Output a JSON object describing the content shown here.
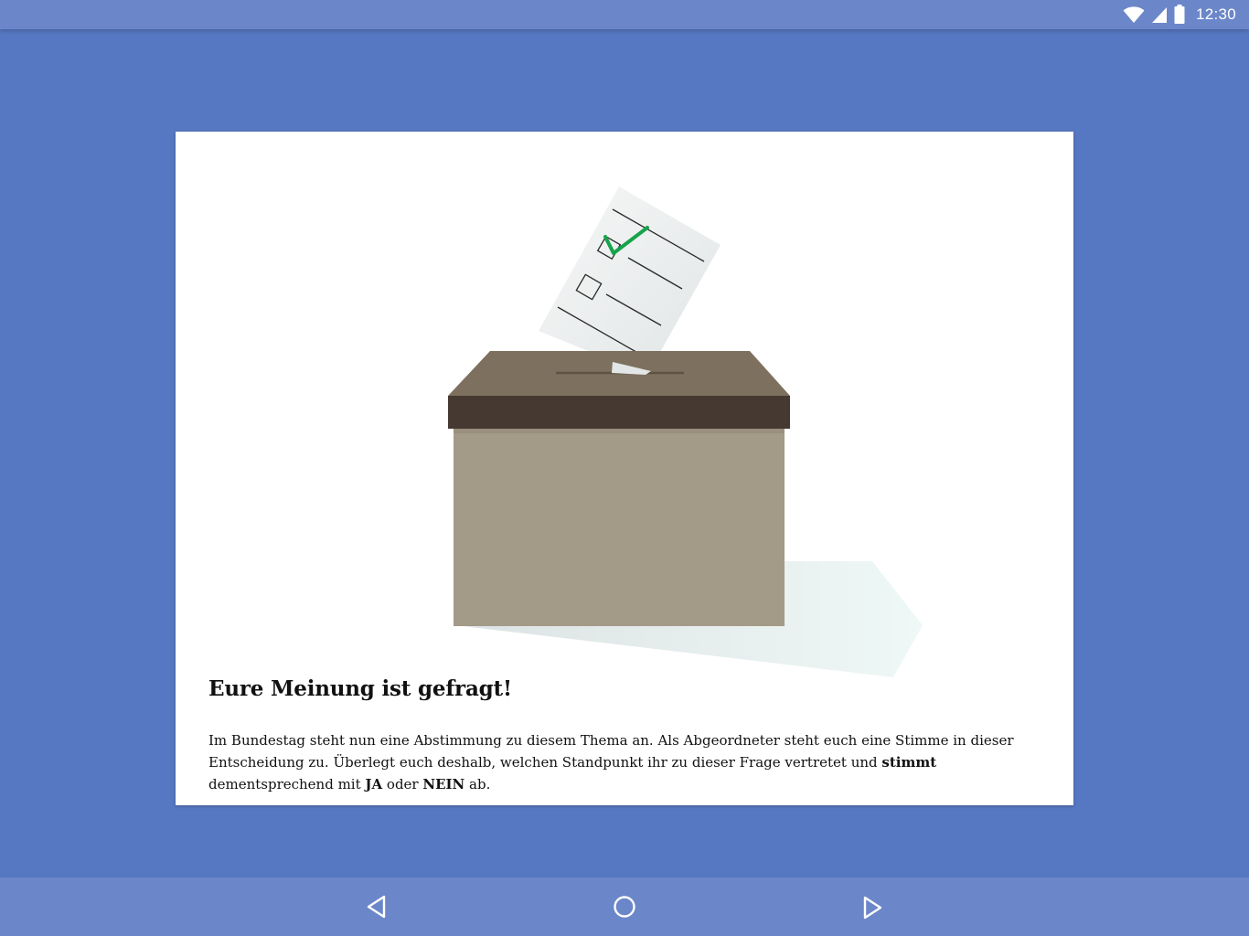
{
  "status_bar": {
    "time": "12:30",
    "icons": [
      "wifi-icon",
      "cellular-signal-icon",
      "battery-icon"
    ]
  },
  "card": {
    "title": "Eure Meinung ist gefragt!",
    "body": [
      {
        "text": "Im Bundestag steht nun eine Abstimmung zu diesem Thema an. Als Abgeordneter steht euch eine Stimme in dieser Entscheidung zu. Überlegt euch deshalb, welchen Standpunkt ihr zu dieser Frage vertretet und ",
        "bold": false
      },
      {
        "text": "stimmt",
        "bold": true
      },
      {
        "text": " dementsprechend mit ",
        "bold": false
      },
      {
        "text": "JA",
        "bold": true
      },
      {
        "text": " oder ",
        "bold": false
      },
      {
        "text": "NEIN",
        "bold": true
      },
      {
        "text": " ab.",
        "bold": false
      }
    ],
    "illustration": "ballot-box-with-ballot-paper"
  },
  "nav_bar": {
    "buttons": [
      "back-icon",
      "home-icon",
      "forward-icon"
    ]
  },
  "colors": {
    "background": "#5677c1",
    "bars": "#6b87c9",
    "check": "#16a34a",
    "box_lid": "#7d705e",
    "box_band": "#453931",
    "box_body": "#a49a88"
  }
}
